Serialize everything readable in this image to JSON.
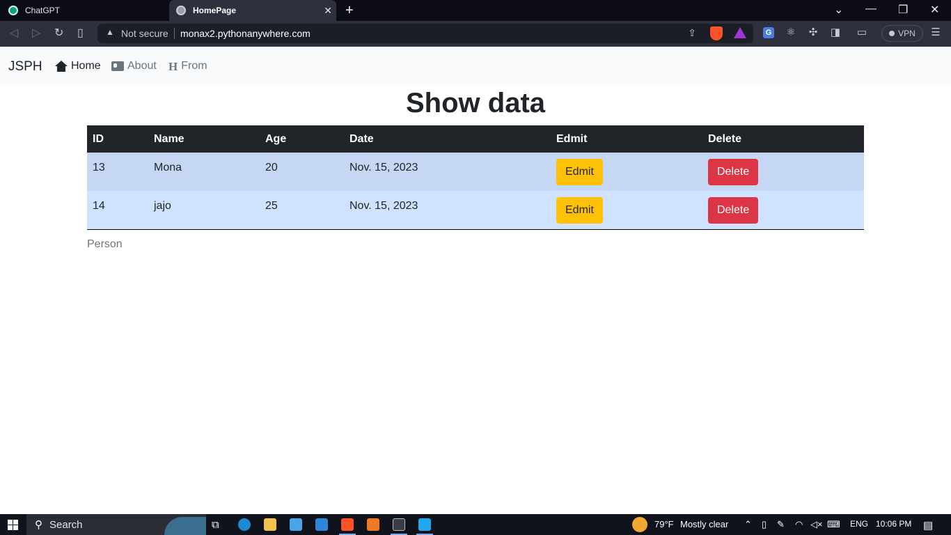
{
  "browser": {
    "tabs": [
      {
        "title": "ChatGPT",
        "active": false
      },
      {
        "title": "HomePage",
        "active": true
      }
    ],
    "security_label": "Not secure",
    "url": "monax2.pythonanywhere.com",
    "vpn_label": "VPN"
  },
  "navbar": {
    "brand": "JSPH",
    "links": [
      {
        "label": "Home",
        "icon": "house-icon",
        "active": true
      },
      {
        "label": "About",
        "icon": "id-card-icon",
        "active": false
      },
      {
        "label": "From",
        "icon": "heading-icon",
        "active": false
      }
    ]
  },
  "page": {
    "title": "Show data",
    "caption": "Person"
  },
  "table": {
    "columns": [
      "ID",
      "Name",
      "Age",
      "Date",
      "Edmit",
      "Delete"
    ],
    "rows": [
      {
        "id": "13",
        "name": "Mona",
        "age": "20",
        "date": "Nov. 15, 2023",
        "edit_label": "Edmit",
        "delete_label": "Delete"
      },
      {
        "id": "14",
        "name": "jajo",
        "age": "25",
        "date": "Nov. 15, 2023",
        "edit_label": "Edmit",
        "delete_label": "Delete"
      }
    ]
  },
  "taskbar": {
    "search_label": "Search",
    "weather_temp": "79°F",
    "weather_desc": "Mostly clear",
    "language": "ENG",
    "time": "10:06 PM"
  },
  "colors": {
    "navbar_bg": "#f8f9fa",
    "table_header_bg": "#212529",
    "row_primary_bg": "#cfe2ff",
    "edit_button": "#ffc107",
    "delete_button": "#dc3545"
  }
}
